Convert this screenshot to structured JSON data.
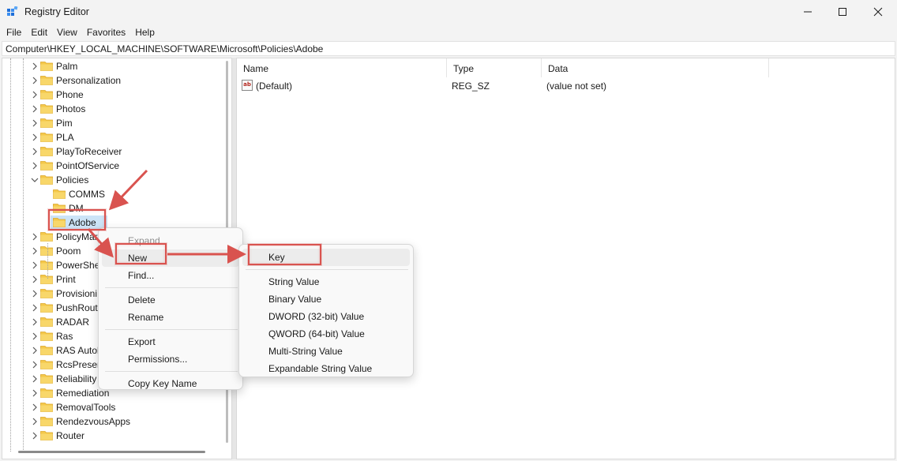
{
  "window": {
    "title": "Registry Editor"
  },
  "menu": [
    "File",
    "Edit",
    "View",
    "Favorites",
    "Help"
  ],
  "address": "Computer\\HKEY_LOCAL_MACHINE\\SOFTWARE\\Microsoft\\Policies\\Adobe",
  "tree": {
    "items": [
      {
        "label": "Palm",
        "level": 1,
        "expander": "collapsed"
      },
      {
        "label": "Personalization",
        "level": 1,
        "expander": "collapsed"
      },
      {
        "label": "Phone",
        "level": 1,
        "expander": "collapsed"
      },
      {
        "label": "Photos",
        "level": 1,
        "expander": "collapsed"
      },
      {
        "label": "Pim",
        "level": 1,
        "expander": "collapsed"
      },
      {
        "label": "PLA",
        "level": 1,
        "expander": "collapsed"
      },
      {
        "label": "PlayToReceiver",
        "level": 1,
        "expander": "collapsed"
      },
      {
        "label": "PointOfService",
        "level": 1,
        "expander": "collapsed"
      },
      {
        "label": "Policies",
        "level": 1,
        "expander": "expanded"
      },
      {
        "label": "COMMS",
        "level": 2,
        "expander": "none"
      },
      {
        "label": "DM",
        "level": 2,
        "expander": "none"
      },
      {
        "label": "Adobe",
        "level": 2,
        "expander": "none",
        "selected": true
      },
      {
        "label": "PolicyMar",
        "level": 1,
        "expander": "collapsed"
      },
      {
        "label": "Poom",
        "level": 1,
        "expander": "collapsed"
      },
      {
        "label": "PowerShe",
        "level": 1,
        "expander": "collapsed"
      },
      {
        "label": "Print",
        "level": 1,
        "expander": "collapsed"
      },
      {
        "label": "Provisioni",
        "level": 1,
        "expander": "collapsed"
      },
      {
        "label": "PushRout",
        "level": 1,
        "expander": "collapsed"
      },
      {
        "label": "RADAR",
        "level": 1,
        "expander": "collapsed"
      },
      {
        "label": "Ras",
        "level": 1,
        "expander": "collapsed"
      },
      {
        "label": "RAS Autol",
        "level": 1,
        "expander": "collapsed"
      },
      {
        "label": "RcsPresen",
        "level": 1,
        "expander": "collapsed"
      },
      {
        "label": "Reliability",
        "level": 1,
        "expander": "collapsed"
      },
      {
        "label": "Remediation",
        "level": 1,
        "expander": "collapsed"
      },
      {
        "label": "RemovalTools",
        "level": 1,
        "expander": "collapsed"
      },
      {
        "label": "RendezvousApps",
        "level": 1,
        "expander": "collapsed"
      },
      {
        "label": "Router",
        "level": 1,
        "expander": "collapsed"
      }
    ]
  },
  "list": {
    "headers": {
      "name": "Name",
      "type": "Type",
      "data": "Data"
    },
    "rows": [
      {
        "name": "(Default)",
        "type": "REG_SZ",
        "data": "(value not set)",
        "icon": "ab",
        "icon_name": "string-value-icon"
      }
    ]
  },
  "context_menu": {
    "items": [
      {
        "label": "Expand",
        "disabled": true
      },
      {
        "label": "New",
        "submenu": true,
        "highlighted": true
      },
      {
        "label": "Find..."
      },
      {
        "separator": true
      },
      {
        "label": "Delete"
      },
      {
        "label": "Rename"
      },
      {
        "separator": true
      },
      {
        "label": "Export"
      },
      {
        "label": "Permissions..."
      },
      {
        "separator": true
      },
      {
        "label": "Copy Key Name"
      }
    ]
  },
  "submenu": {
    "items": [
      {
        "label": "Key",
        "highlighted": true
      },
      {
        "separator": true
      },
      {
        "label": "String Value"
      },
      {
        "label": "Binary Value"
      },
      {
        "label": "DWORD (32-bit) Value"
      },
      {
        "label": "QWORD (64-bit) Value"
      },
      {
        "label": "Multi-String Value"
      },
      {
        "label": "Expandable String Value"
      }
    ]
  },
  "colors": {
    "annotation": "#d9534f",
    "folder": "#f4c84a",
    "folder_dark": "#dba72a",
    "selection": "#cce4f7"
  }
}
